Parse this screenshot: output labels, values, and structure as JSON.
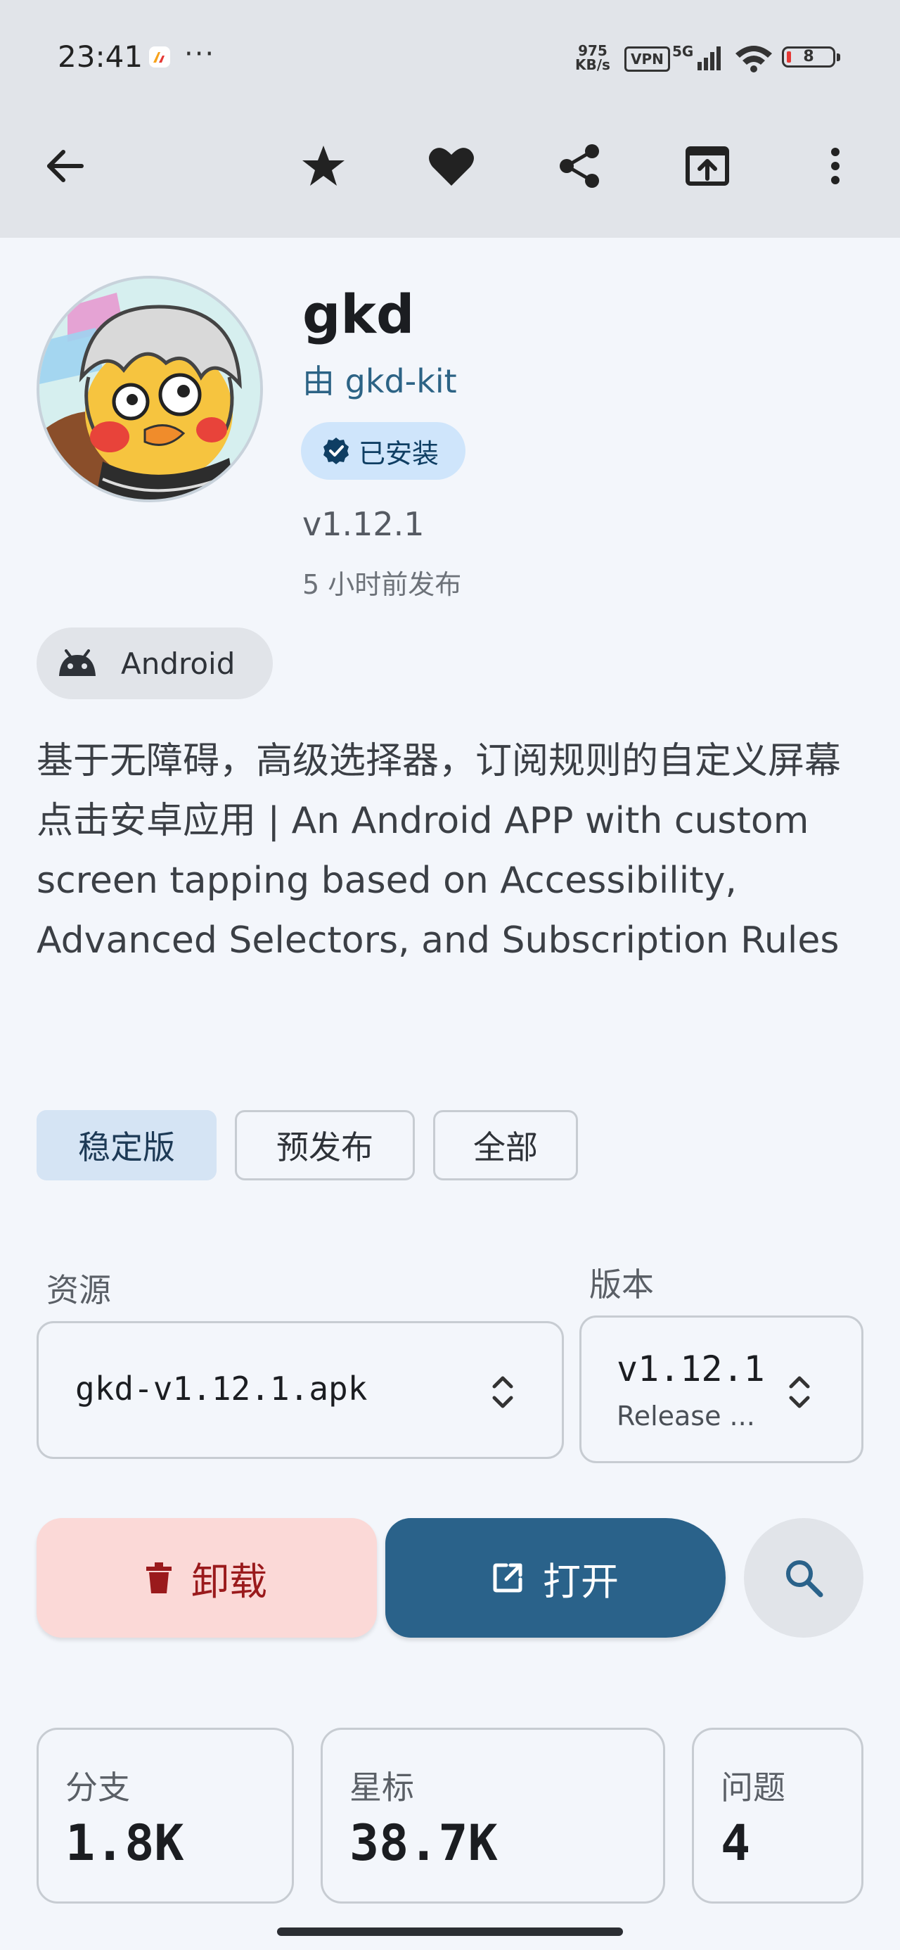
{
  "status_bar": {
    "time": "23:41",
    "dots": "···",
    "speed_top": "975",
    "speed_bottom": "KB/s",
    "vpn": "VPN",
    "network": "5G",
    "battery": "8",
    "battery_color": "#e53935"
  },
  "app_bar": {
    "icons": [
      "back-arrow-icon",
      "star-icon",
      "heart-icon",
      "share-icon",
      "open-external-icon",
      "more-vert-icon"
    ]
  },
  "app": {
    "name": "gkd",
    "author": "由 gkd-kit",
    "installed_badge": "已安装",
    "version": "v1.12.1",
    "published": "5 小时前发布",
    "platform": "Android",
    "description": "基于无障碍，高级选择器，订阅规则的自定义屏幕点击安卓应用 | An Android APP with custom screen tapping based on Accessibility, Advanced Selectors, and Subscription Rules"
  },
  "release_filter": {
    "chips": [
      {
        "label": "稳定版",
        "selected": true
      },
      {
        "label": "预发布",
        "selected": false
      },
      {
        "label": "全部",
        "selected": false
      }
    ]
  },
  "asset_selector": {
    "source_label": "资源",
    "source_value": "gkd-v1.12.1.apk",
    "version_label": "版本",
    "version_value": "v1.12.1",
    "version_sub": "Release ..."
  },
  "actions": {
    "uninstall": "卸载",
    "open": "打开",
    "uninstall_color": "#9a1a1c",
    "open_color": "#2a628a"
  },
  "stats": [
    {
      "label": "分支",
      "value": "1.8K"
    },
    {
      "label": "星标",
      "value": "38.7K"
    },
    {
      "label": "问题",
      "value": "4"
    }
  ]
}
